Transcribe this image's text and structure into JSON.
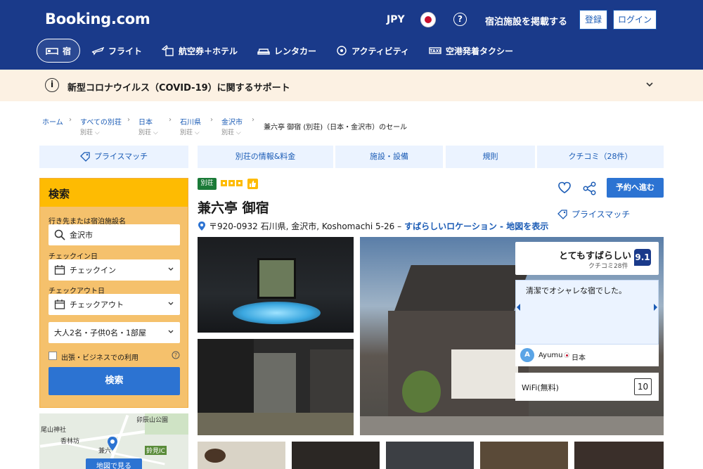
{
  "header": {
    "logo": "Booking.com",
    "currency": "JPY",
    "help": "?",
    "list_property": "宿泊施設を掲載する",
    "register": "登録",
    "login": "ログイン"
  },
  "nav": {
    "items": [
      {
        "label": "宿",
        "icon": "bed-icon"
      },
      {
        "label": "フライト",
        "icon": "plane-icon"
      },
      {
        "label": "航空券＋ホテル",
        "icon": "flight-hotel-icon"
      },
      {
        "label": "レンタカー",
        "icon": "car-icon"
      },
      {
        "label": "アクティビティ",
        "icon": "attractions-icon"
      },
      {
        "label": "空港発着タクシー",
        "icon": "taxi-icon"
      }
    ]
  },
  "covid": {
    "icon_text": "i",
    "text": "新型コロナウイルス（COVID-19）に関するサポート"
  },
  "breadcrumb": {
    "items": [
      {
        "label": "ホーム",
        "sub": ""
      },
      {
        "label": "すべての別荘",
        "sub": "別荘 ⌵"
      },
      {
        "label": "日本",
        "sub": "別荘 ⌵"
      },
      {
        "label": "石川県",
        "sub": "別荘 ⌵"
      },
      {
        "label": "金沢市",
        "sub": "別荘 ⌵"
      }
    ],
    "current": "兼六亭 御宿 (別荘)（日本・金沢市）のセール"
  },
  "tabs": {
    "price_match": "プライスマッチ",
    "items": [
      "別荘の情報&料金",
      "施設・設備",
      "規則",
      "クチコミ（28件）"
    ]
  },
  "search": {
    "title": "検索",
    "dest_label": "行き先または宿泊施設名",
    "dest_value": "金沢市",
    "checkin_label": "チェックイン日",
    "checkin_value": "チェックイン",
    "checkout_label": "チェックアウト日",
    "checkout_value": "チェックアウト",
    "guests": "大人2名・子供0名・1部屋",
    "business": "出張・ビジネスでの利用",
    "button": "検索"
  },
  "map": {
    "labels": [
      "卯辰山公園",
      "尾山神社",
      "香林坊",
      "兼六",
      "鈴見IC"
    ],
    "button": "地図で見る"
  },
  "property": {
    "type": "別荘",
    "stars": 3,
    "name": "兼六亭 御宿",
    "address": "〒920-0932 石川県, 金沢市, Koshomachi 5-26 –",
    "location_link": "すばらしいロケーション - 地図を表示",
    "reserve": "予約へ進む",
    "price_match": "プライスマッチ"
  },
  "review": {
    "word": "とてもすばらしい",
    "count": "クチコミ28件",
    "score": "9.1",
    "quote": "清潔でオシャレな宿でした。",
    "user_initial": "A",
    "user_name": "Ayumu",
    "user_country": "日本",
    "wifi_label": "WiFi(無料)",
    "wifi_score": "10"
  },
  "colors": {
    "brand_blue": "#1a3a8a",
    "action_blue": "#2c73d2",
    "search_yellow": "#febb02",
    "badge_green": "#1a7a37"
  }
}
